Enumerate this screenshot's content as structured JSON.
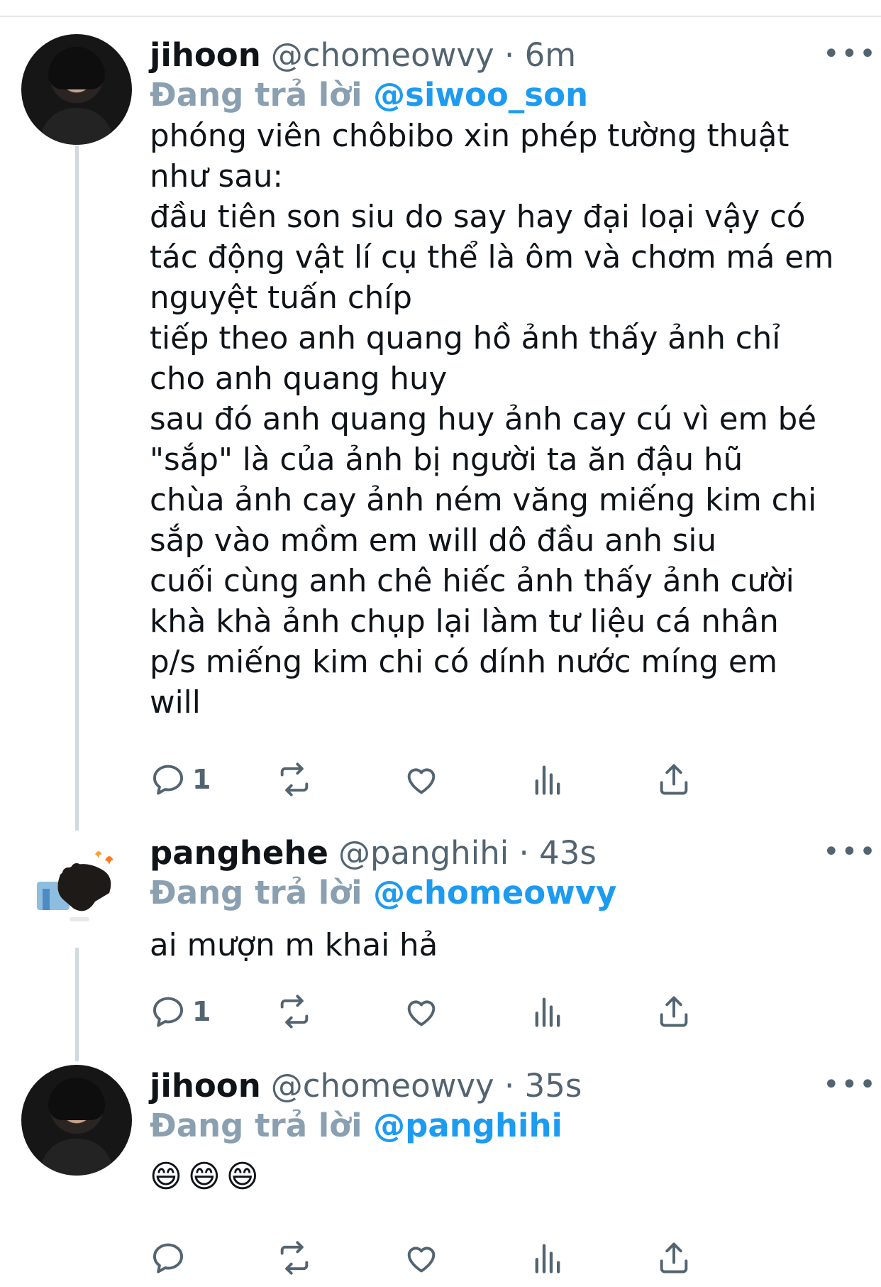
{
  "colors": {
    "link": "#1d9bf0",
    "muted": "#536471",
    "thread_line": "#cfd9de"
  },
  "tweets": [
    {
      "avatar_icon": "profile-photo-jihoon",
      "name": "jihoon",
      "meta": "@chomeowvy · 6m",
      "reply_prefix": "Đang trả lời",
      "reply_handle": "@siwoo_son",
      "more": "•••",
      "text": "phóng viên chôbibo xin phép tường thuật\nnhư sau:\nđầu tiên son siu do say hay đại loại vậy có\ntác động vật lí cụ thể là ôm và chơm má em\nnguyệt tuấn chíp\ntiếp theo anh quang hồ ảnh thấy ảnh chỉ\ncho anh quang huy\nsau đó anh quang huy ảnh cay cú vì em bé\n\"sắp\" là của ảnh bị người ta ăn đậu hũ\nchùa ảnh cay ảnh ném văng miếng kim chi\nsắp vào mồm em will dô đầu anh siu\ncuối cùng anh chê hiếc ảnh thấy ảnh cười\nkhà khà ảnh chụp lại làm tư liệu cá nhân\np/s miếng kim chi có dính nước míng em\nwill",
      "reply_count": "1"
    },
    {
      "avatar_icon": "profile-photo-panghehe",
      "name": "panghehe",
      "meta": "@panghihi · 43s",
      "reply_prefix": "Đang trả lời",
      "reply_handle": "@chomeowvy",
      "more": "•••",
      "text": "ai mượn m khai hả",
      "reply_count": "1"
    },
    {
      "avatar_icon": "profile-photo-jihoon",
      "name": "jihoon",
      "meta": "@chomeowvy · 35s",
      "reply_prefix": "Đang trả lời",
      "reply_handle": "@panghihi",
      "more": "•••",
      "emojis": "😄😄😄",
      "reply_count": ""
    }
  ],
  "action_icons": [
    "reply-icon",
    "retweet-icon",
    "like-icon",
    "analytics-icon",
    "share-icon"
  ]
}
